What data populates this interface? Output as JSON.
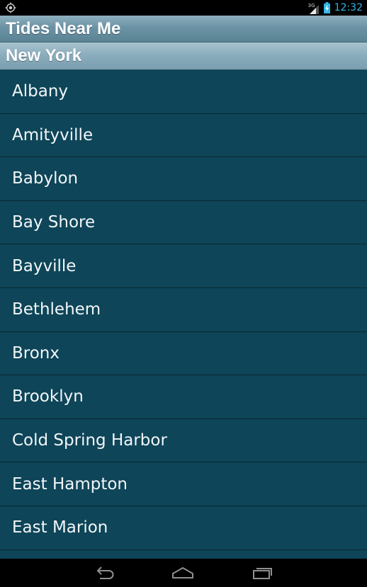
{
  "status_bar": {
    "network_type": "3G",
    "time": "12:32",
    "icons": [
      "location-target-icon",
      "signal-icon",
      "battery-charging-icon"
    ]
  },
  "app": {
    "title": "Tides Near Me",
    "subtitle": "New York"
  },
  "list": {
    "items": [
      {
        "label": "Albany"
      },
      {
        "label": "Amityville"
      },
      {
        "label": "Babylon"
      },
      {
        "label": "Bay Shore"
      },
      {
        "label": "Bayville"
      },
      {
        "label": "Bethlehem"
      },
      {
        "label": "Bronx"
      },
      {
        "label": "Brooklyn"
      },
      {
        "label": "Cold Spring Harbor"
      },
      {
        "label": "East Hampton"
      },
      {
        "label": "East Marion"
      }
    ]
  },
  "nav_bar": {
    "icons": [
      "back-icon",
      "home-icon",
      "recent-apps-icon"
    ]
  },
  "colors": {
    "accent": "#33b5e5",
    "list_background": "#0e4558"
  }
}
